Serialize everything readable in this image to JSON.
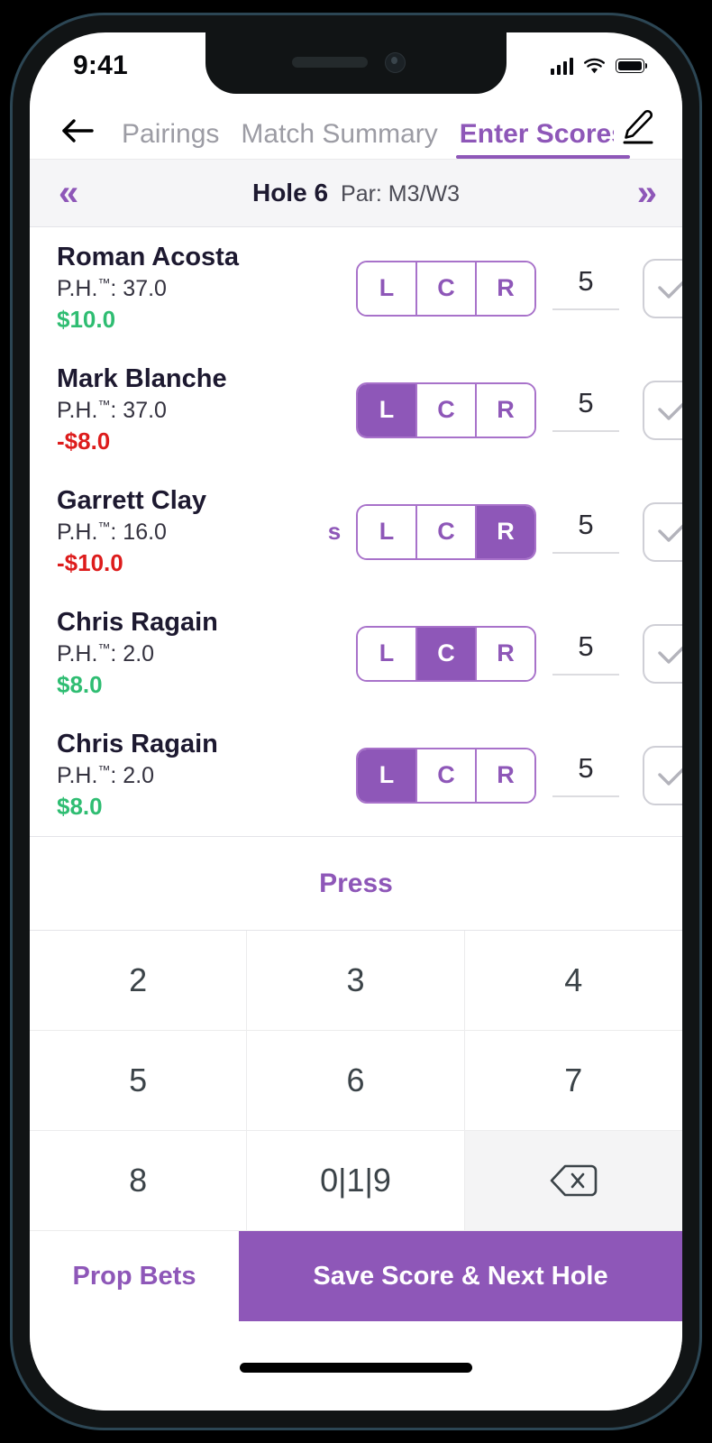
{
  "colors": {
    "accent_purple": "#8e57b8",
    "accent_purple_border": "#a872ca",
    "money_positive": "#2fbd72",
    "money_negative": "#dd1c1c",
    "text_dark": "#1d1930",
    "tab_inactive": "#9c9ca4",
    "bar_background": "#f5f5f7"
  },
  "status_bar": {
    "time": "9:41",
    "signal_icon": "cellular-signal-icon",
    "wifi_icon": "wifi-icon",
    "battery_icon": "battery-full-icon"
  },
  "navbar": {
    "back_icon": "back-arrow-icon",
    "edit_icon": "pencil-icon",
    "tabs": [
      {
        "label": "Pairings",
        "active": false
      },
      {
        "label": "Match Summary",
        "active": false
      },
      {
        "label": "Enter Scores",
        "active": true
      }
    ]
  },
  "hole_bar": {
    "prev_icon": "chevron-double-left-icon",
    "next_icon": "chevron-double-right-icon",
    "prev_glyph": "«",
    "next_glyph": "»",
    "hole_label": "Hole 6",
    "par_label": "Par: M3/W3"
  },
  "players": [
    {
      "name": "Roman Acosta",
      "handicap": "P.H.™: 37.0",
      "money": "$10.0",
      "money_sign": "pos",
      "s_flag": "",
      "lcr": [
        "L",
        "C",
        "R"
      ],
      "selected": "",
      "score": "5",
      "confirm_icon": "checkmark-icon"
    },
    {
      "name": "Mark Blanche",
      "handicap": "P.H.™: 37.0",
      "money": "-$8.0",
      "money_sign": "neg",
      "s_flag": "",
      "lcr": [
        "L",
        "C",
        "R"
      ],
      "selected": "L",
      "score": "5",
      "confirm_icon": "checkmark-icon"
    },
    {
      "name": "Garrett Clay",
      "handicap": "P.H.™: 16.0",
      "money": "-$10.0",
      "money_sign": "neg",
      "s_flag": "s",
      "lcr": [
        "L",
        "C",
        "R"
      ],
      "selected": "R",
      "score": "5",
      "confirm_icon": "checkmark-icon"
    },
    {
      "name": "Chris Ragain",
      "handicap": "P.H.™: 2.0",
      "money": "$8.0",
      "money_sign": "pos",
      "s_flag": "",
      "lcr": [
        "L",
        "C",
        "R"
      ],
      "selected": "C",
      "score": "5",
      "confirm_icon": "checkmark-icon"
    },
    {
      "name": "Chris Ragain",
      "handicap": "P.H.™: 2.0",
      "money": "$8.0",
      "money_sign": "pos",
      "s_flag": "",
      "lcr": [
        "L",
        "C",
        "R"
      ],
      "selected": "L",
      "score": "5",
      "confirm_icon": "checkmark-icon"
    }
  ],
  "press": {
    "label": "Press"
  },
  "keypad": {
    "keys": [
      {
        "label": "2",
        "type": "digit"
      },
      {
        "label": "3",
        "type": "digit"
      },
      {
        "label": "4",
        "type": "digit"
      },
      {
        "label": "5",
        "type": "digit"
      },
      {
        "label": "6",
        "type": "digit"
      },
      {
        "label": "7",
        "type": "digit"
      },
      {
        "label": "8",
        "type": "digit"
      },
      {
        "label": "0|1|9",
        "type": "multi"
      },
      {
        "label": "",
        "type": "backspace",
        "icon": "backspace-icon"
      }
    ]
  },
  "actions": {
    "prop_bets_label": "Prop Bets",
    "save_label": "Save Score & Next Hole"
  }
}
